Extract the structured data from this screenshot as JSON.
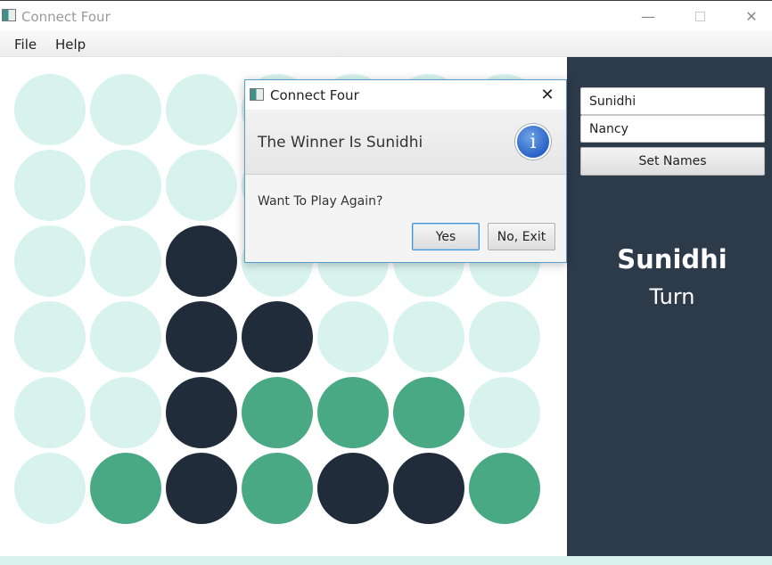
{
  "window": {
    "title": "Connect Four",
    "controls": {
      "minimize": "—",
      "close": "✕"
    }
  },
  "menu": {
    "file": "File",
    "help": "Help"
  },
  "board": {
    "columns": 7,
    "rows": 6,
    "cells": [
      [
        "empty",
        "empty",
        "empty",
        "empty",
        "empty",
        "empty",
        "empty"
      ],
      [
        "empty",
        "empty",
        "empty",
        "empty",
        "empty",
        "empty",
        "empty"
      ],
      [
        "empty",
        "empty",
        "dark",
        "empty",
        "empty",
        "empty",
        "empty"
      ],
      [
        "empty",
        "empty",
        "dark",
        "dark",
        "empty",
        "empty",
        "empty"
      ],
      [
        "empty",
        "empty",
        "dark",
        "green",
        "green",
        "green",
        "empty"
      ],
      [
        "empty",
        "green",
        "dark",
        "green",
        "dark",
        "dark",
        "green"
      ]
    ],
    "colors": {
      "empty": "#d8f3ee",
      "dark": "#212c3b",
      "green": "#4aa985"
    }
  },
  "side_panel": {
    "player1_name": "Sunidhi",
    "player2_name": "Nancy",
    "set_names_label": "Set Names",
    "current_player": "Sunidhi",
    "turn_label": "Turn",
    "background": "#2c3a4a"
  },
  "dialog": {
    "title": "Connect Four",
    "close": "✕",
    "header_text": "The Winner Is Sunidhi",
    "info_icon_glyph": "i",
    "content_text": "Want To Play Again?",
    "yes_label": "Yes",
    "no_label": "No, Exit"
  }
}
